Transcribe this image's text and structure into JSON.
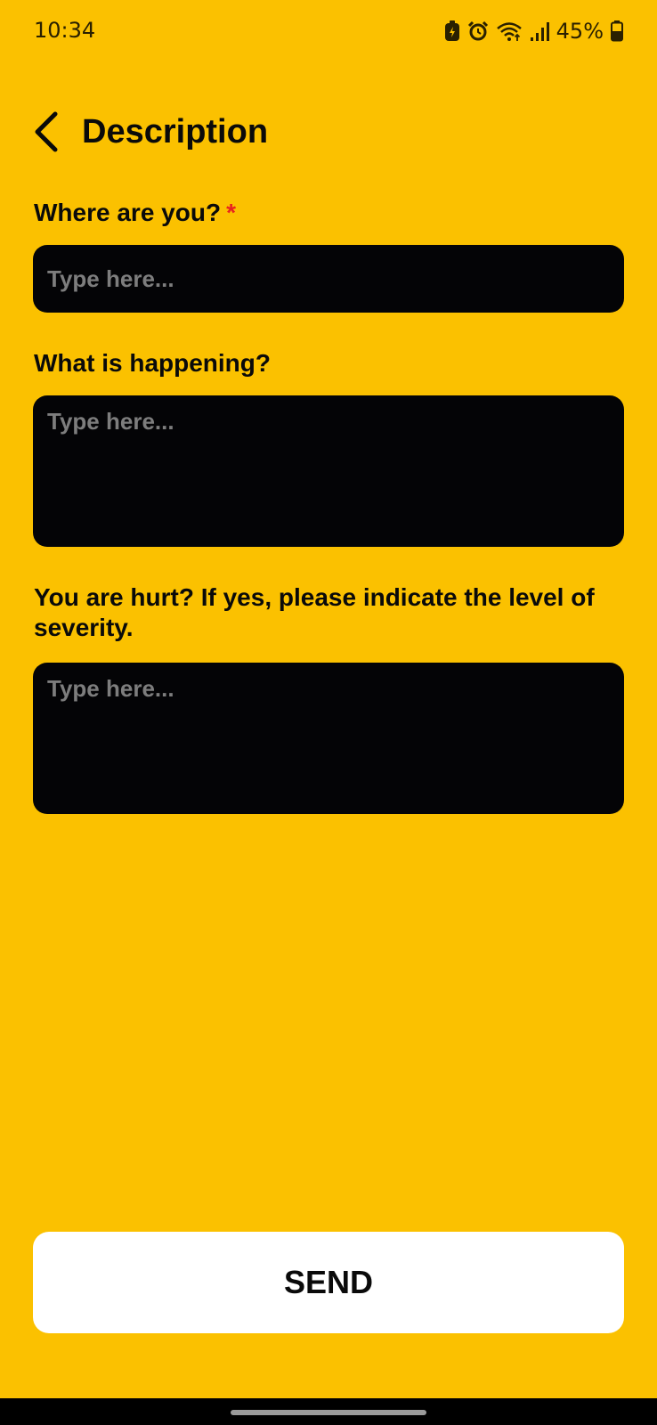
{
  "status_bar": {
    "time": "10:34",
    "battery_percent": "45%",
    "icons": [
      "battery-saver-icon",
      "alarm-icon",
      "wifi-icon",
      "signal-icon",
      "battery-icon"
    ]
  },
  "header": {
    "title": "Description",
    "back_icon": "chevron-left-icon"
  },
  "form": {
    "location": {
      "label": "Where are you?",
      "required_mark": "*",
      "placeholder": "Type here..."
    },
    "situation": {
      "label": "What is happening?",
      "placeholder": "Type here..."
    },
    "injury": {
      "label": "You are hurt? If yes, please indicate the level of severity.",
      "placeholder": "Type here..."
    }
  },
  "actions": {
    "send_label": "SEND"
  },
  "colors": {
    "background": "#FBC100",
    "input_background": "#040406",
    "placeholder": "#7D7D7D",
    "required": "#E8231F",
    "button_background": "#FFFFFF"
  }
}
